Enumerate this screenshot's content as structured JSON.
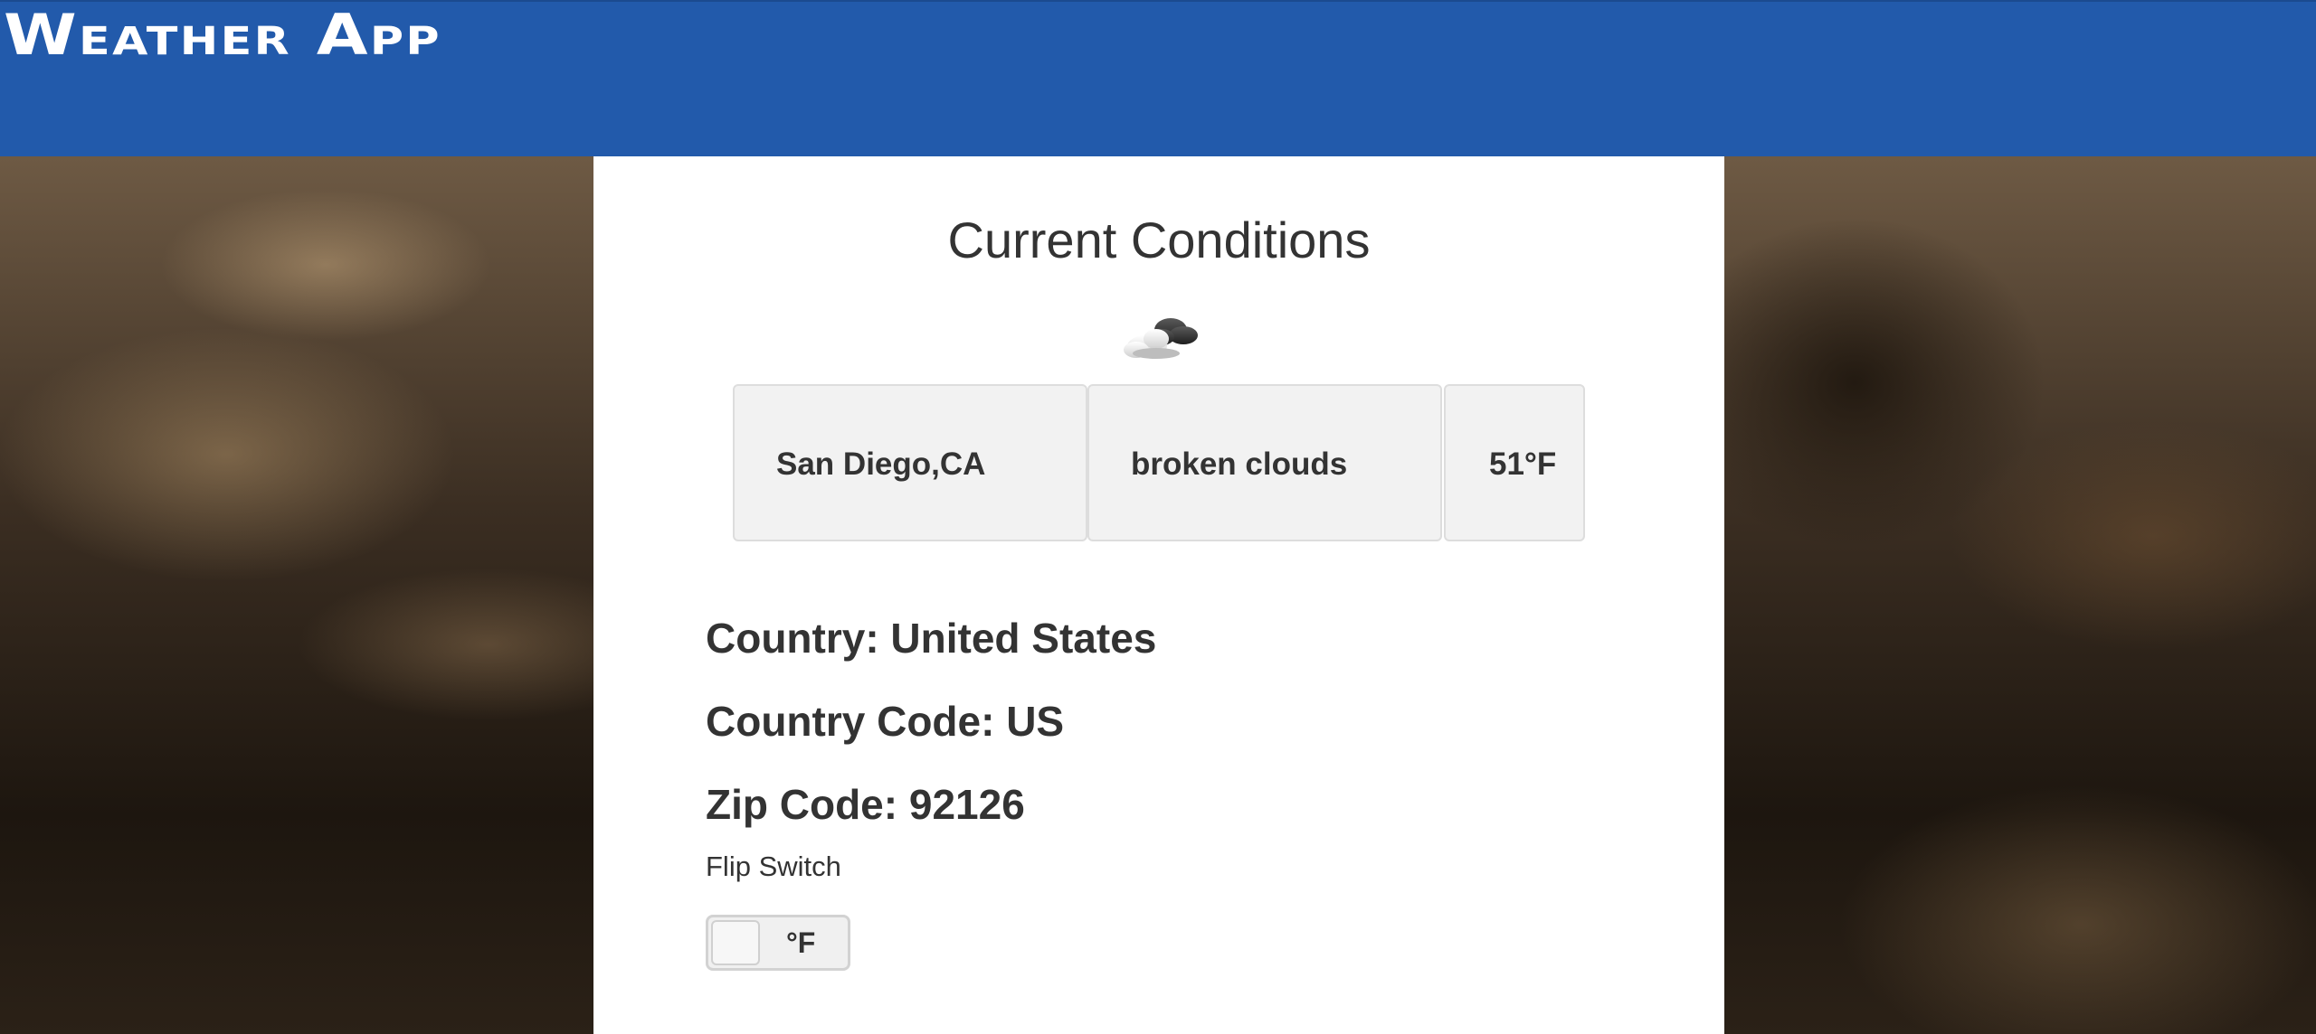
{
  "header": {
    "title": "Weather App",
    "background_color": "#225aab"
  },
  "main": {
    "heading": "Current Conditions",
    "weather_icon": "broken-clouds-icon",
    "cards": {
      "location": "San Diego,CA",
      "description": "broken clouds",
      "temperature": "51°F"
    },
    "details": {
      "country": "Country: United States",
      "country_code": "Country Code: US",
      "zip_code": "Zip Code: 92126"
    },
    "flip_switch": {
      "label": "Flip Switch",
      "value": "°F"
    }
  }
}
